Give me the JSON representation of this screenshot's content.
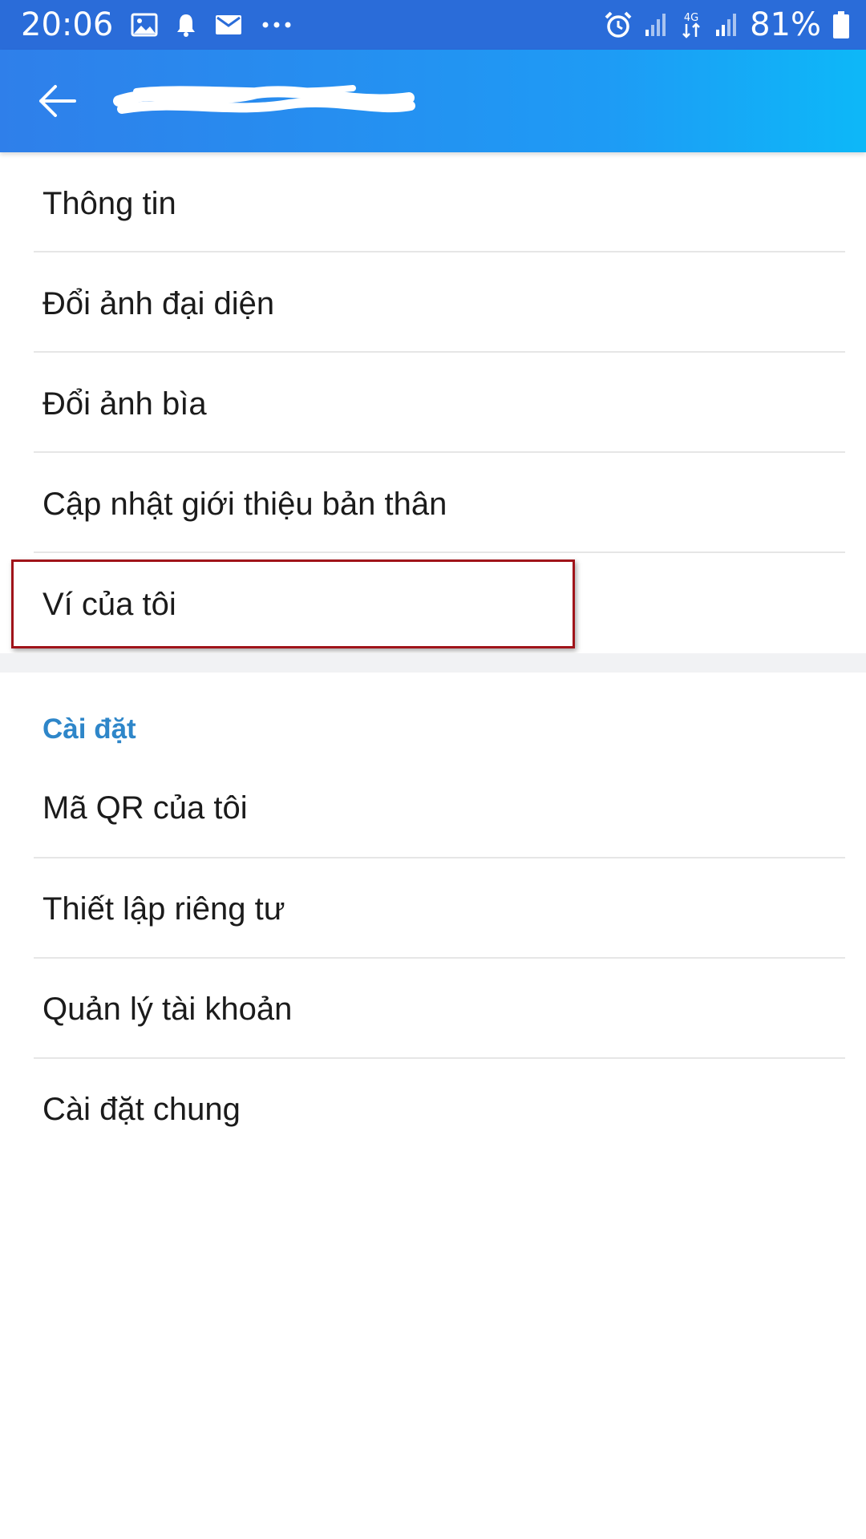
{
  "status_bar": {
    "time": "20:06",
    "left_icons": [
      "image-icon",
      "bell-icon",
      "mail-icon",
      "more-dots-icon"
    ],
    "network_label": "4G",
    "battery_percent": "81%",
    "background": "#2A6CD9"
  },
  "app_bar": {
    "title": "",
    "back_icon": "arrow-left-icon",
    "gradient": [
      "#2F7FEA",
      "#0DB8F8"
    ]
  },
  "profile_section": {
    "items": [
      {
        "label": "Thông tin"
      },
      {
        "label": "Đổi ảnh đại diện"
      },
      {
        "label": "Đổi ảnh bìa"
      },
      {
        "label": "Cập nhật giới thiệu bản thân"
      },
      {
        "label": "Ví của tôi"
      }
    ]
  },
  "settings_section": {
    "header": "Cài đặt",
    "header_color": "#2E86C9",
    "items": [
      {
        "label": "Mã QR của tôi"
      },
      {
        "label": "Thiết lập riêng tư"
      },
      {
        "label": "Quản lý tài khoản"
      },
      {
        "label": "Cài đặt chung"
      }
    ]
  },
  "annotation": {
    "highlighted_item": "Ví của tôi",
    "border_color": "#A0141A"
  }
}
